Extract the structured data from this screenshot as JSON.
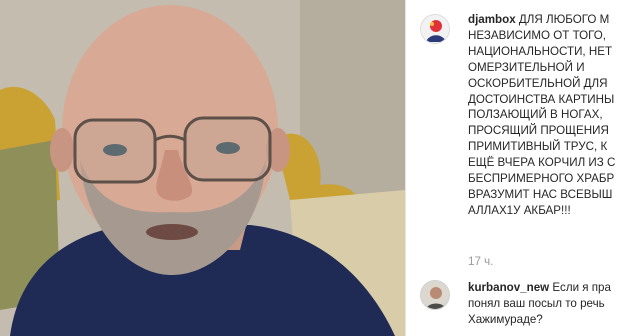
{
  "video": {
    "accent_colors": {
      "shirt": "#1f2a55",
      "chair_gold": "#c9a233",
      "chair_fabric": "#8f8f5a",
      "wall": "#c4bcae"
    }
  },
  "comments": [
    {
      "username": "djambox",
      "lines": [
        "ДЛЯ ЛЮБОГО М",
        "НЕЗАВИСИМО ОТ ТОГО,",
        "НАЦИОНАЛЬНОСТИ, НЕТ",
        "ОМЕРЗИТЕЛЬНОЙ И",
        "ОСКОРБИТЕЛЬНОЙ ДЛЯ",
        "ДОСТОИНСТВА КАРТИНЫ",
        "ПОЛЗАЮЩИЙ В НОГАХ,",
        "ПРОСЯЩИЙ ПРОЩЕНИЯ",
        "ПРИМИТИВНЫЙ ТРУС, К",
        "ЕЩЁ ВЧЕРА КОРЧИЛ ИЗ С",
        "БЕСПРИМЕРНОГО ХРАБР",
        "ВРАЗУМИТ НАС ВСЕВЫШ",
        "АЛЛАХ1У АКБАР!!!"
      ],
      "time": "17 ч."
    },
    {
      "username": "kurbanov_new",
      "lines": [
        "Если я пра",
        "понял ваш посыл то речь",
        "Хажимураде?"
      ]
    }
  ]
}
